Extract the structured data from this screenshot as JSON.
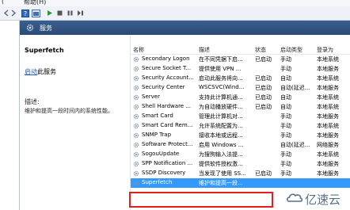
{
  "menubar": {
    "left_text": "(",
    "help_label": "帮助(H)"
  },
  "header": {
    "title": "服务"
  },
  "detail": {
    "service_name": "Superfetch",
    "start_link": "启动",
    "start_suffix": "此服务",
    "description_label": "描述:",
    "description": "维护和提高一段时间内的系统性能。"
  },
  "columns": {
    "name": "名称",
    "desc": "描述",
    "status": "状态",
    "startup": "启动类型",
    "logon": "登录为"
  },
  "rows": [
    {
      "name": "Secondary Logon",
      "desc": "在不同凭据下启...",
      "status": "已启动",
      "startup": "手动",
      "logon": "本地系统"
    },
    {
      "name": "Secure Socket T...",
      "desc": "提供使用 VPN ...",
      "status": "",
      "startup": "手动",
      "logon": "本地服务"
    },
    {
      "name": "Security Account...",
      "desc": "启动此服务将向...",
      "status": "已启动",
      "startup": "自动",
      "logon": "本地系统"
    },
    {
      "name": "Security Center",
      "desc": "WSCSVC(Wind...",
      "status": "已启动",
      "startup": "自动(延迟...",
      "logon": "本地服务"
    },
    {
      "name": "Server",
      "desc": "支持此计算机通...",
      "status": "已启动",
      "startup": "自动",
      "logon": "本地系统"
    },
    {
      "name": "Shell Hardware ...",
      "desc": "为自动播放硬件...",
      "status": "已启动",
      "startup": "自动",
      "logon": "本地系统"
    },
    {
      "name": "Smart Card",
      "desc": "管理此计算机对...",
      "status": "",
      "startup": "手动",
      "logon": "本地服务"
    },
    {
      "name": "Smart Card Rem...",
      "desc": "允许系统配置为...",
      "status": "",
      "startup": "手动",
      "logon": "本地系统"
    },
    {
      "name": "SNMP Trap",
      "desc": "接收本地或远程...",
      "status": "",
      "startup": "手动",
      "logon": "本地服务"
    },
    {
      "name": "Software Protect...",
      "desc": "启用 Windows ...",
      "status": "",
      "startup": "自动(延迟...",
      "logon": "网络服务"
    },
    {
      "name": "SogouUpdate",
      "desc": "为搜狗输入法提...",
      "status": "",
      "startup": "手动",
      "logon": "本地系统"
    },
    {
      "name": "SPP Notification ...",
      "desc": "提供软件授权激...",
      "status": "",
      "startup": "手动",
      "logon": "本地服务"
    },
    {
      "name": "SSDP Discovery",
      "desc": "当发现了使用 SS...",
      "status": "已启动",
      "startup": "手动",
      "logon": "本地服务"
    },
    {
      "name": "Superfetch",
      "desc": "维护和提高一段...",
      "status": "",
      "startup": "",
      "logon": ""
    }
  ],
  "watermark": {
    "text": "亿速云"
  },
  "colors": {
    "header_bg": "#2b4a74",
    "selection": "#3399ff",
    "highlight_border": "#e02020",
    "link": "#1f5fbf"
  }
}
